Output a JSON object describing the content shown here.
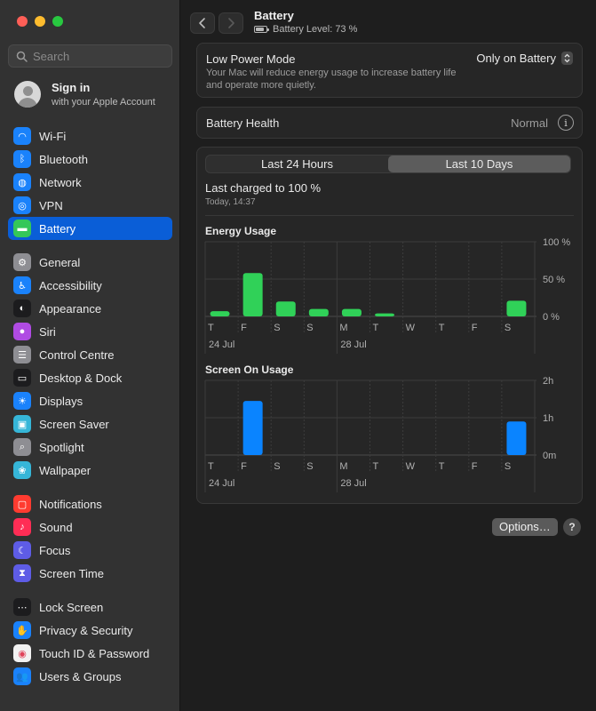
{
  "search": {
    "placeholder": "Search"
  },
  "account": {
    "title": "Sign in",
    "subtitle": "with your Apple Account"
  },
  "sidebar": {
    "groups": [
      [
        {
          "label": "Wi-Fi",
          "icon": "wifi-icon",
          "color": "#1a82fb",
          "glyph": "◠"
        },
        {
          "label": "Bluetooth",
          "icon": "bluetooth-icon",
          "color": "#1a82fb",
          "glyph": "ᛒ"
        },
        {
          "label": "Network",
          "icon": "globe-icon",
          "color": "#1a82fb",
          "glyph": "◍"
        },
        {
          "label": "VPN",
          "icon": "vpn-icon",
          "color": "#1a82fb",
          "glyph": "◎"
        },
        {
          "label": "Battery",
          "icon": "battery-icon",
          "color": "#34c759",
          "glyph": "▬",
          "active": true
        }
      ],
      [
        {
          "label": "General",
          "icon": "gear-icon",
          "color": "#8e8e93",
          "glyph": "⚙"
        },
        {
          "label": "Accessibility",
          "icon": "accessibility-icon",
          "color": "#1a82fb",
          "glyph": "♿"
        },
        {
          "label": "Appearance",
          "icon": "appearance-icon",
          "color": "#1c1c1e",
          "glyph": "◐"
        },
        {
          "label": "Siri",
          "icon": "siri-icon",
          "color": "#b04be3",
          "glyph": "●"
        },
        {
          "label": "Control Centre",
          "icon": "control-centre-icon",
          "color": "#8e8e93",
          "glyph": "☰"
        },
        {
          "label": "Desktop & Dock",
          "icon": "dock-icon",
          "color": "#1c1c1e",
          "glyph": "▭"
        },
        {
          "label": "Displays",
          "icon": "displays-icon",
          "color": "#1a82fb",
          "glyph": "☀"
        },
        {
          "label": "Screen Saver",
          "icon": "screen-saver-icon",
          "color": "#36b6d8",
          "glyph": "▣"
        },
        {
          "label": "Spotlight",
          "icon": "spotlight-icon",
          "color": "#8e8e93",
          "glyph": "⌕"
        },
        {
          "label": "Wallpaper",
          "icon": "wallpaper-icon",
          "color": "#36b6d8",
          "glyph": "❀"
        }
      ],
      [
        {
          "label": "Notifications",
          "icon": "notifications-icon",
          "color": "#ff3b30",
          "glyph": "▢"
        },
        {
          "label": "Sound",
          "icon": "sound-icon",
          "color": "#ff2d55",
          "glyph": "♪"
        },
        {
          "label": "Focus",
          "icon": "focus-icon",
          "color": "#5e5ce6",
          "glyph": "☾"
        },
        {
          "label": "Screen Time",
          "icon": "screen-time-icon",
          "color": "#5e5ce6",
          "glyph": "⧗"
        }
      ],
      [
        {
          "label": "Lock Screen",
          "icon": "lock-icon",
          "color": "#1c1c1e",
          "glyph": "⋯"
        },
        {
          "label": "Privacy & Security",
          "icon": "hand-icon",
          "color": "#1a82fb",
          "glyph": "✋"
        },
        {
          "label": "Touch ID & Password",
          "icon": "fingerprint-icon",
          "color": "#f2f2f2",
          "glyph": "◉"
        },
        {
          "label": "Users & Groups",
          "icon": "users-icon",
          "color": "#1a82fb",
          "glyph": "👥"
        }
      ]
    ]
  },
  "header": {
    "title": "Battery",
    "subtitle": "Battery Level: 73 %"
  },
  "low_power": {
    "title": "Low Power Mode",
    "description": "Your Mac will reduce energy usage to increase battery life and operate more quietly.",
    "value": "Only on Battery"
  },
  "health": {
    "label": "Battery Health",
    "value": "Normal"
  },
  "usage": {
    "tabs": [
      "Last 24 Hours",
      "Last 10 Days"
    ],
    "selected_tab": 1,
    "last_charged": "Last charged to 100 %",
    "last_charged_time": "Today, 14:37"
  },
  "chart_data": [
    {
      "type": "bar",
      "title": "Energy Usage",
      "categories": [
        "T",
        "F",
        "S",
        "S",
        "M",
        "T",
        "W",
        "T",
        "F",
        "S"
      ],
      "date_labels": [
        {
          "index": 0,
          "text": "24 Jul"
        },
        {
          "index": 4,
          "text": "28 Jul"
        }
      ],
      "values": [
        7,
        58,
        20,
        10,
        10,
        4,
        0,
        0,
        0,
        21
      ],
      "yticks": [
        "100 %",
        "50 %",
        "0 %"
      ],
      "ylim": [
        0,
        100
      ],
      "color": "#30d158"
    },
    {
      "type": "bar",
      "title": "Screen On Usage",
      "categories": [
        "T",
        "F",
        "S",
        "S",
        "M",
        "T",
        "W",
        "T",
        "F",
        "S"
      ],
      "date_labels": [
        {
          "index": 0,
          "text": "24 Jul"
        },
        {
          "index": 4,
          "text": "28 Jul"
        }
      ],
      "values": [
        0,
        1.45,
        0,
        0,
        0,
        0,
        0,
        0,
        0,
        0.9
      ],
      "yticks": [
        "2h",
        "1h",
        "0m"
      ],
      "ylim": [
        0,
        2
      ],
      "unit": "h",
      "color": "#0a84ff"
    }
  ],
  "footer": {
    "options_label": "Options…",
    "help_label": "?"
  }
}
